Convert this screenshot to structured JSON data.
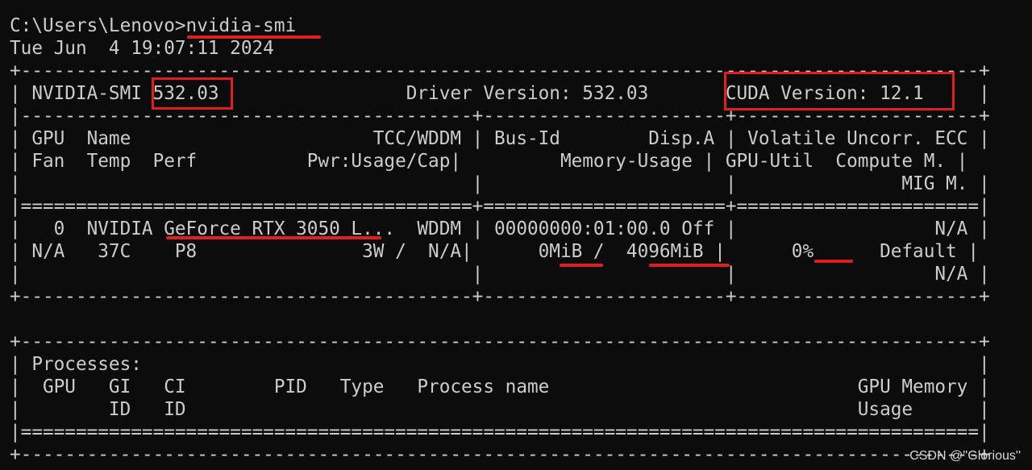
{
  "terminal": {
    "lines": [
      "C:\\Users\\Lenovo>nvidia-smi",
      "Tue Jun  4 19:07:11 2024",
      "+---------------------------------------------------------------------------------------+",
      "| NVIDIA-SMI 532.03                 Driver Version: 532.03       CUDA Version: 12.1     |",
      "|-----------------------------------------+----------------------+----------------------+",
      "| GPU  Name                      TCC/WDDM | Bus-Id        Disp.A | Volatile Uncorr. ECC |",
      "| Fan  Temp  Perf          Pwr:Usage/Cap|         Memory-Usage | GPU-Util  Compute M. |",
      "|                                         |                      |               MIG M. |",
      "|=========================================+======================+======================|",
      "|   0  NVIDIA GeForce RTX 3050 L...  WDDM | 00000000:01:00.0 Off |                  N/A |",
      "| N/A   37C    P8               3W /  N/A|      0MiB /  4096MiB |      0%      Default |",
      "|                                         |                      |                  N/A |",
      "+-----------------------------------------+----------------------+----------------------+",
      "",
      "+---------------------------------------------------------------------------------------+",
      "| Processes:                                                                            |",
      "|  GPU   GI   CI        PID   Type   Process name                            GPU Memory |",
      "|        ID   ID                                                             Usage      |",
      "|=======================================================================================|",
      "+---------------------------------------------------------------------------------------+"
    ]
  },
  "watermark": "CSDN @''Glorious''",
  "colors": {
    "background": "#0c0c0c",
    "text": "#cccccc",
    "annotation": "#e02020"
  }
}
